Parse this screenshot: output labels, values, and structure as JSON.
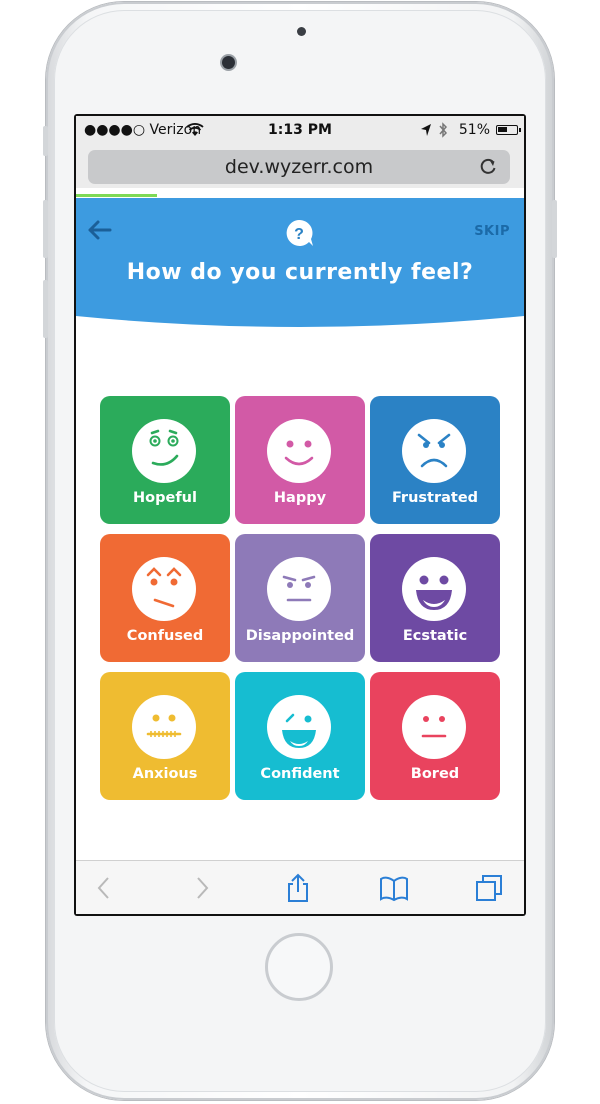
{
  "status_bar": {
    "carrier": "●●●●○ Verizon",
    "time": "1:13 PM",
    "battery": "51%"
  },
  "browser": {
    "url": "dev.wyzerr.com",
    "load_progress": 0.18
  },
  "header": {
    "skip_label": "SKIP",
    "question": "How do you currently feel?",
    "color": "#3d9be0"
  },
  "moods": [
    {
      "label": "Hopeful",
      "color": "#2bab5b",
      "face": "hopeful"
    },
    {
      "label": "Happy",
      "color": "#d25aa6",
      "face": "happy"
    },
    {
      "label": "Frustrated",
      "color": "#2b82c5",
      "face": "frustrated"
    },
    {
      "label": "Confused",
      "color": "#f06a34",
      "face": "confused"
    },
    {
      "label": "Disappointed",
      "color": "#8e7ab8",
      "face": "disappointed"
    },
    {
      "label": "Ecstatic",
      "color": "#6e4aa3",
      "face": "ecstatic"
    },
    {
      "label": "Anxious",
      "color": "#efbc31",
      "face": "anxious"
    },
    {
      "label": "Confident",
      "color": "#16bdd1",
      "face": "confident"
    },
    {
      "label": "Bored",
      "color": "#e9435e",
      "face": "bored"
    }
  ],
  "toolbar_icons": [
    "back-icon",
    "forward-icon",
    "share-icon",
    "bookmarks-icon",
    "tabs-icon"
  ]
}
